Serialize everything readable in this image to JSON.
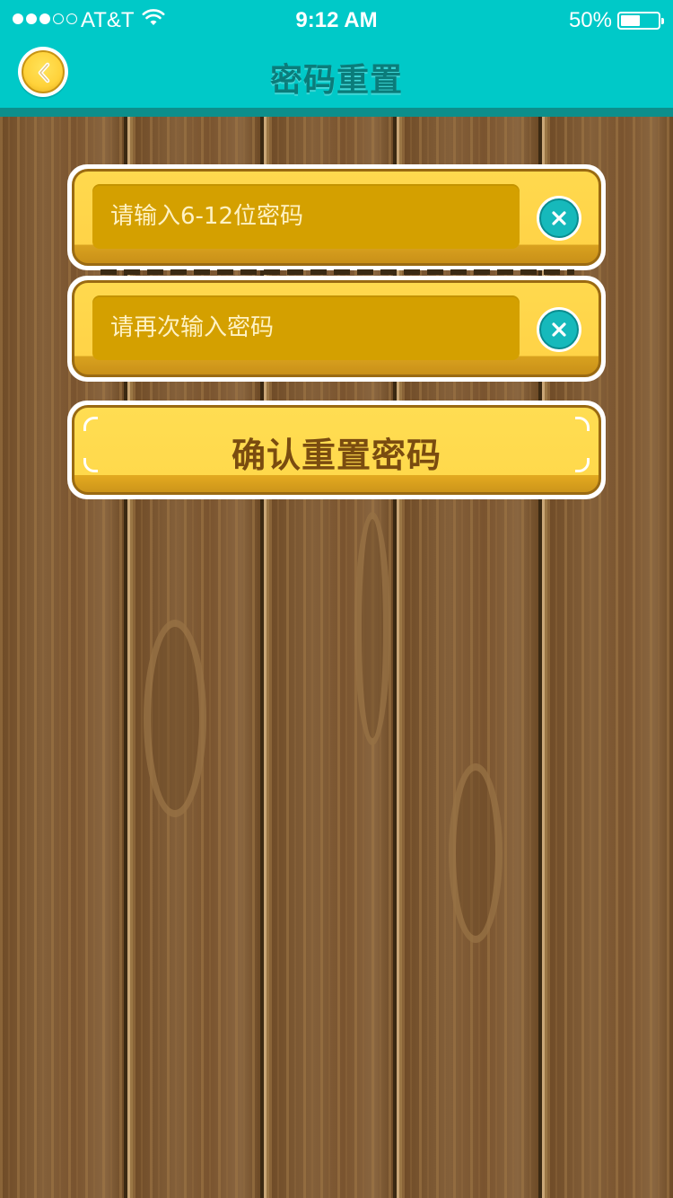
{
  "status_bar": {
    "carrier": "AT&T",
    "time": "9:12 AM",
    "battery": "50%"
  },
  "nav": {
    "title": "密码重置"
  },
  "form": {
    "password_placeholder": "请输入6-12位密码",
    "confirm_placeholder": "请再次输入密码",
    "password_value": "",
    "confirm_value": ""
  },
  "actions": {
    "confirm_label": "确认重置密码"
  },
  "icons": {
    "back": "chevron-left-icon",
    "clear": "close-icon",
    "wifi": "wifi-icon",
    "battery": "battery-icon"
  },
  "colors": {
    "header": "#00c9c8",
    "header_title": "#0b7c7a",
    "button_yellow": "#ffd94e",
    "field_gold": "#d4a000",
    "clear_teal": "#16b9bb",
    "wood": "#7c5631"
  }
}
